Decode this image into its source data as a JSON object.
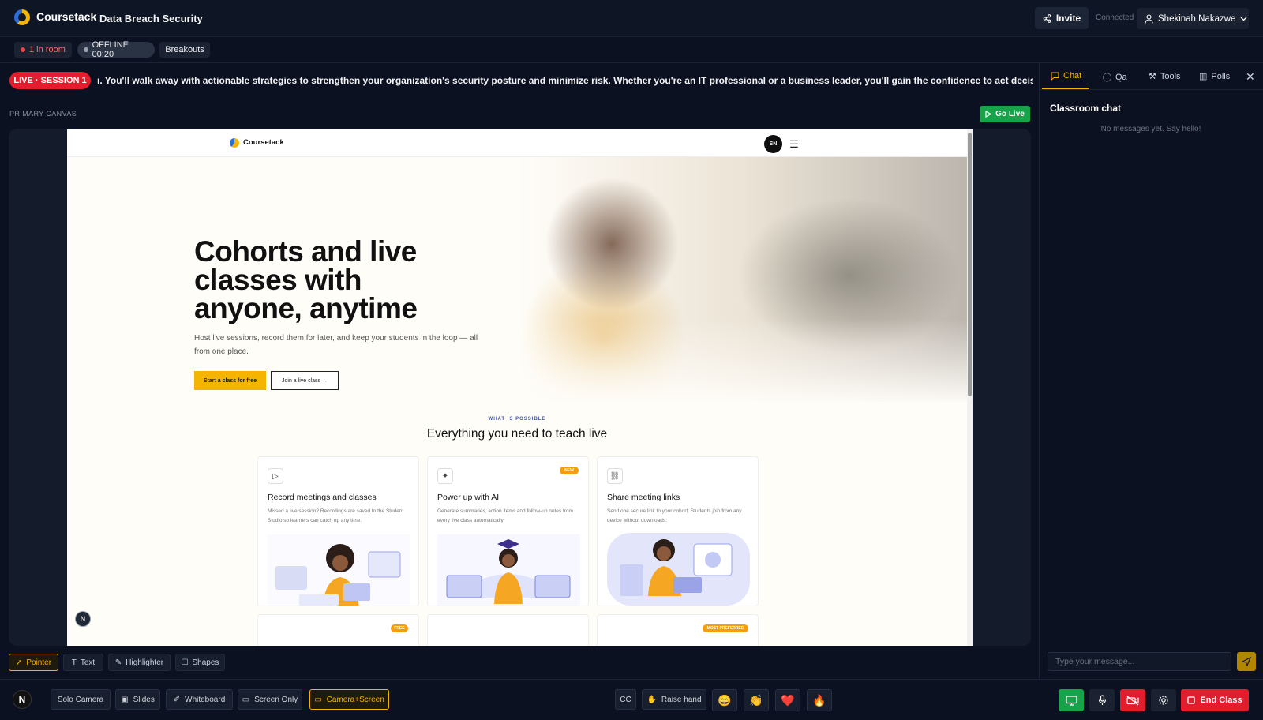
{
  "header": {
    "brand": "Coursetack",
    "course_title": "Data Breach Security",
    "invite_label": "Invite",
    "connection_status": "Connected",
    "user_name": "Shekinah Nakazwe"
  },
  "subbar": {
    "in_room": "1 in room",
    "offline": "OFFLINE 00:20",
    "breakouts": "Breakouts"
  },
  "ticker": {
    "badge": "LIVE · SESSION 1",
    "text": "ı. You'll walk away with actionable strategies to strengthen your organization's security posture and minimize risk. Whether you're an IT professional or a business leader, you'll gain the confidence to act decisively when it"
  },
  "canvas": {
    "label": "PRIMARY CANVAS",
    "go_live": "Go Live",
    "floating_avatar": "N"
  },
  "shared_page": {
    "brand": "Coursetack",
    "avatar": "SN",
    "hero_title": "Cohorts and live classes with anyone, anytime",
    "hero_sub": "Host live sessions, record them for later, and keep your students in the loop — all from one place.",
    "cta_primary": "Start a class for free",
    "cta_secondary": "Join a live class →",
    "kicker": "WHAT IS POSSIBLE",
    "section_title": "Everything you need to teach live",
    "cards": [
      {
        "title": "Record meetings and classes",
        "desc": "Missed a live session? Recordings are saved to the Student Studio so learners can catch up any time.",
        "badge": ""
      },
      {
        "title": "Power up with AI",
        "desc": "Generate summaries, action items and follow-up notes from every live class automatically.",
        "badge": "NEW"
      },
      {
        "title": "Share meeting links",
        "desc": "Send one secure link to your cohort. Students join from any device without downloads.",
        "badge": ""
      }
    ],
    "row2_badges": [
      "FREE",
      "MOST PREFERRED"
    ]
  },
  "draw_tools": {
    "pointer": "Pointer",
    "text": "Text",
    "highlighter": "Highlighter",
    "shapes": "Shapes"
  },
  "bottombar": {
    "avatar": "N",
    "solo_camera": "Solo Camera",
    "slides": "Slides",
    "whiteboard": "Whiteboard",
    "screen_only": "Screen Only",
    "camera_screen": "Camera+Screen",
    "cc": "CC",
    "raise_hand": "Raise hand",
    "reactions": [
      "😄",
      "👏",
      "❤️",
      "🔥"
    ],
    "end_class": "End Class"
  },
  "panel": {
    "tabs": [
      "Chat",
      "Qa",
      "Tools",
      "Polls"
    ],
    "chat_title": "Classroom chat",
    "empty": "No messages yet. Say hello!",
    "input_placeholder": "Type your message..."
  },
  "colors": {
    "accent": "#f5b400",
    "live_red": "#e11d2e",
    "go_live_green": "#16a34a",
    "background": "#0b1120"
  }
}
